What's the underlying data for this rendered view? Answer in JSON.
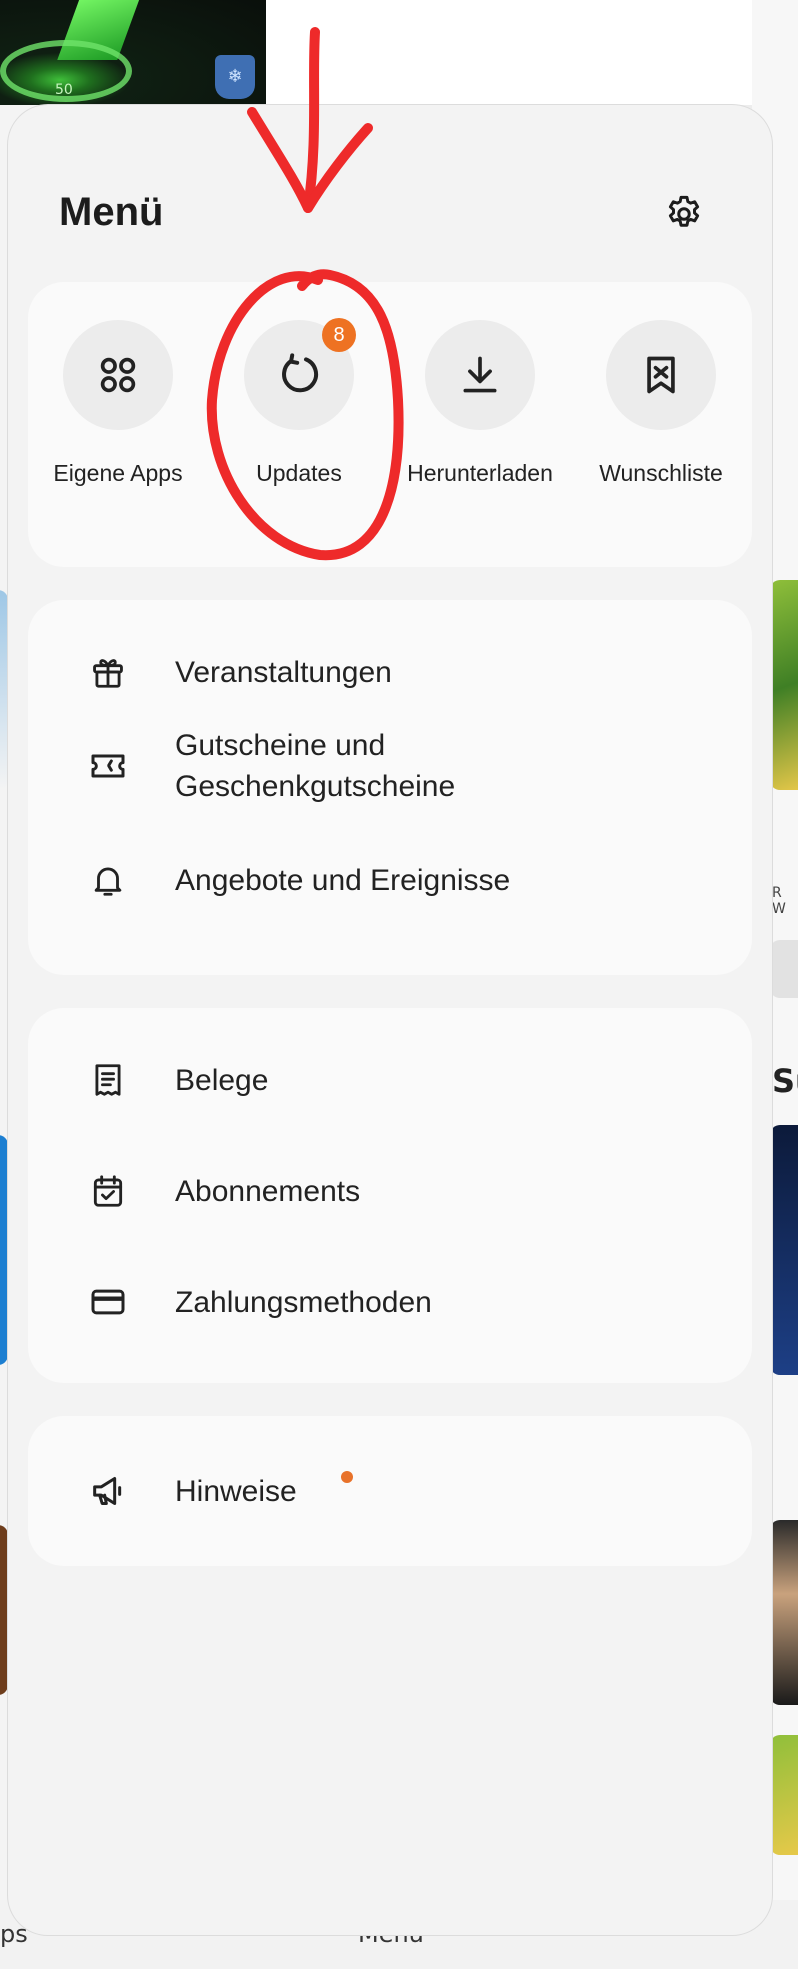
{
  "menu": {
    "title": "Menü"
  },
  "quick_actions": [
    {
      "label": "Eigene Apps",
      "icon": "apps-grid-icon"
    },
    {
      "label": "Updates",
      "icon": "update-icon",
      "badge": "8"
    },
    {
      "label": "Herunterladen",
      "icon": "download-icon"
    },
    {
      "label": "Wunschliste",
      "icon": "wishlist-bookmark-icon"
    }
  ],
  "section_offers": [
    {
      "label": "Veranstaltungen",
      "icon": "gift-icon"
    },
    {
      "label": "Gutscheine und Geschenkgutscheine",
      "line1": "Gutscheine und",
      "line2": "Geschenkgutscheine",
      "icon": "ticket-icon"
    },
    {
      "label": "Angebote und Ereignisse",
      "icon": "bell-icon"
    }
  ],
  "section_account": [
    {
      "label": "Belege",
      "icon": "receipt-icon"
    },
    {
      "label": "Abonnements",
      "icon": "calendar-check-icon"
    },
    {
      "label": "Zahlungsmethoden",
      "icon": "credit-card-icon"
    }
  ],
  "section_notices": [
    {
      "label": "Hinweise",
      "icon": "megaphone-icon",
      "has_new": true
    }
  ],
  "background": {
    "bottom_nav_left": "ps",
    "bottom_nav_center": "Menü",
    "right_fragment_1": "R W",
    "right_fragment_2": "Su",
    "game_badge_number": "50"
  },
  "colors": {
    "badge": "#ee7222",
    "annotation": "#ee2a2a",
    "sheet_background": "#f3f3f3",
    "card_background": "#fafafa"
  }
}
